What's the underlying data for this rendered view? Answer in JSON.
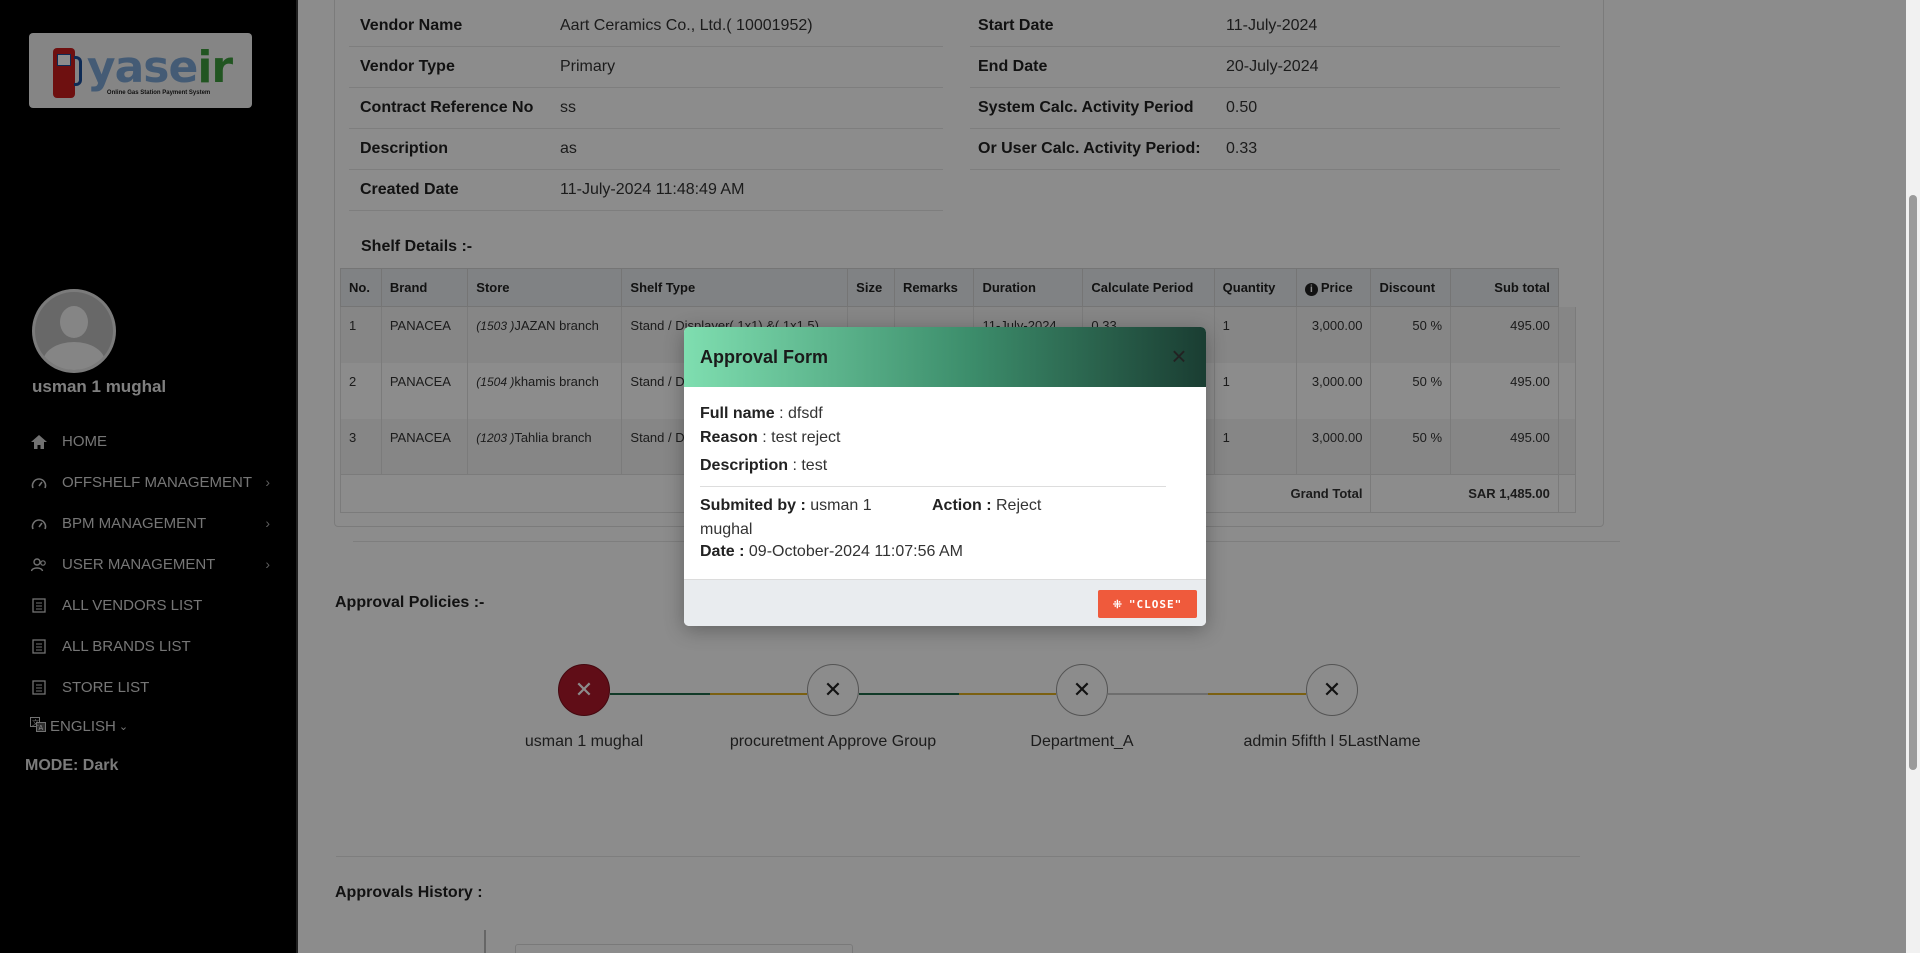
{
  "sidebar": {
    "logo": {
      "text_main": "yase",
      "text_accent": "ir",
      "tagline": "Online Gas Station Payment System"
    },
    "username": "usman 1 mughal",
    "items": [
      {
        "label": "HOME",
        "icon": "home-icon",
        "chevron": false
      },
      {
        "label": "OFFSHELF MANAGEMENT",
        "icon": "gauge-icon",
        "chevron": true
      },
      {
        "label": "BPM MANAGEMENT",
        "icon": "gauge-icon",
        "chevron": true
      },
      {
        "label": "USER MANAGEMENT",
        "icon": "users-icon",
        "chevron": true
      },
      {
        "label": "ALL VENDORS LIST",
        "icon": "list-icon",
        "chevron": false
      },
      {
        "label": "ALL BRANDS LIST",
        "icon": "list-icon",
        "chevron": false
      },
      {
        "label": "STORE LIST",
        "icon": "list-icon",
        "chevron": false
      }
    ],
    "language": "ENGLISH",
    "mode": "MODE: Dark"
  },
  "info_left": [
    {
      "label": "Vendor Name",
      "value": "Aart Ceramics Co., Ltd.( 10001952)"
    },
    {
      "label": "Vendor Type",
      "value": "Primary"
    },
    {
      "label": "Contract Reference No",
      "value": "ss"
    },
    {
      "label": "Description",
      "value": "as"
    },
    {
      "label": "Created Date",
      "value": "11-July-2024 11:48:49 AM"
    }
  ],
  "info_right": [
    {
      "label": "Start Date",
      "value": "11-July-2024"
    },
    {
      "label": "End Date",
      "value": "20-July-2024"
    },
    {
      "label": "System Calc. Activity Period",
      "value": "0.50"
    },
    {
      "label": "Or User Calc. Activity Period:",
      "value": "0.33"
    }
  ],
  "shelf": {
    "title": "Shelf Details :-",
    "columns": [
      "No.",
      "Brand",
      "Store",
      "Shelf Type",
      "Size",
      "Remarks",
      "Duration",
      "Calculate Period",
      "Quantity",
      "Price",
      "Discount",
      "Sub total"
    ],
    "rows": [
      {
        "no": "1",
        "brand": "PANACEA",
        "store_code": "(1503 )",
        "store": "JAZAN branch",
        "shelf_type": "Stand / Displayer( 1x1) &( 1x1.5)",
        "size": "",
        "remarks": "",
        "duration": "11-July-2024",
        "period": "0.33",
        "qty": "1",
        "price": "3,000.00",
        "discount": "50 %",
        "subtotal": "495.00"
      },
      {
        "no": "2",
        "brand": "PANACEA",
        "store_code": "(1504 )",
        "store": "khamis branch",
        "shelf_type": "Stand / D",
        "size": "",
        "remarks": "",
        "duration": "",
        "period": "",
        "qty": "1",
        "price": "3,000.00",
        "discount": "50 %",
        "subtotal": "495.00"
      },
      {
        "no": "3",
        "brand": "PANACEA",
        "store_code": "(1203 )",
        "store": "Tahlia branch",
        "shelf_type": "Stand / D",
        "size": "",
        "remarks": "",
        "duration": "",
        "period": "",
        "qty": "1",
        "price": "3,000.00",
        "discount": "50 %",
        "subtotal": "495.00"
      }
    ],
    "grand_total_label": "Grand Total",
    "grand_total_value": "SAR 1,485.00"
  },
  "policies": {
    "title": "Approval Policies :-",
    "steps": [
      {
        "name": "usman 1 mughal",
        "status": "rejected"
      },
      {
        "name": "procuretment Approve Group",
        "status": "pending"
      },
      {
        "name": "Department_A",
        "status": "pending"
      },
      {
        "name": "admin 5fifth l 5LastName",
        "status": "pending"
      }
    ],
    "colors": {
      "rejected": "#b0182a",
      "line_green": "#1f6b4a",
      "line_yellow": "#e0b020",
      "line_grey": "#c8c8c8"
    }
  },
  "history": {
    "title": "Approvals History :"
  },
  "modal": {
    "title": "Approval Form",
    "full_name_label": "Full name",
    "full_name": "dfsdf",
    "reason_label": "Reason",
    "reason": "test reject",
    "description_label": "Description",
    "description": "test",
    "submitted_by_label": "Submited by :",
    "submitted_by": "usman 1 mughal",
    "action_label": "Action :",
    "action": "Reject",
    "date_label": "Date :",
    "date": "09-October-2024 11:07:56 AM",
    "close_label": "\"CLOSE\""
  }
}
